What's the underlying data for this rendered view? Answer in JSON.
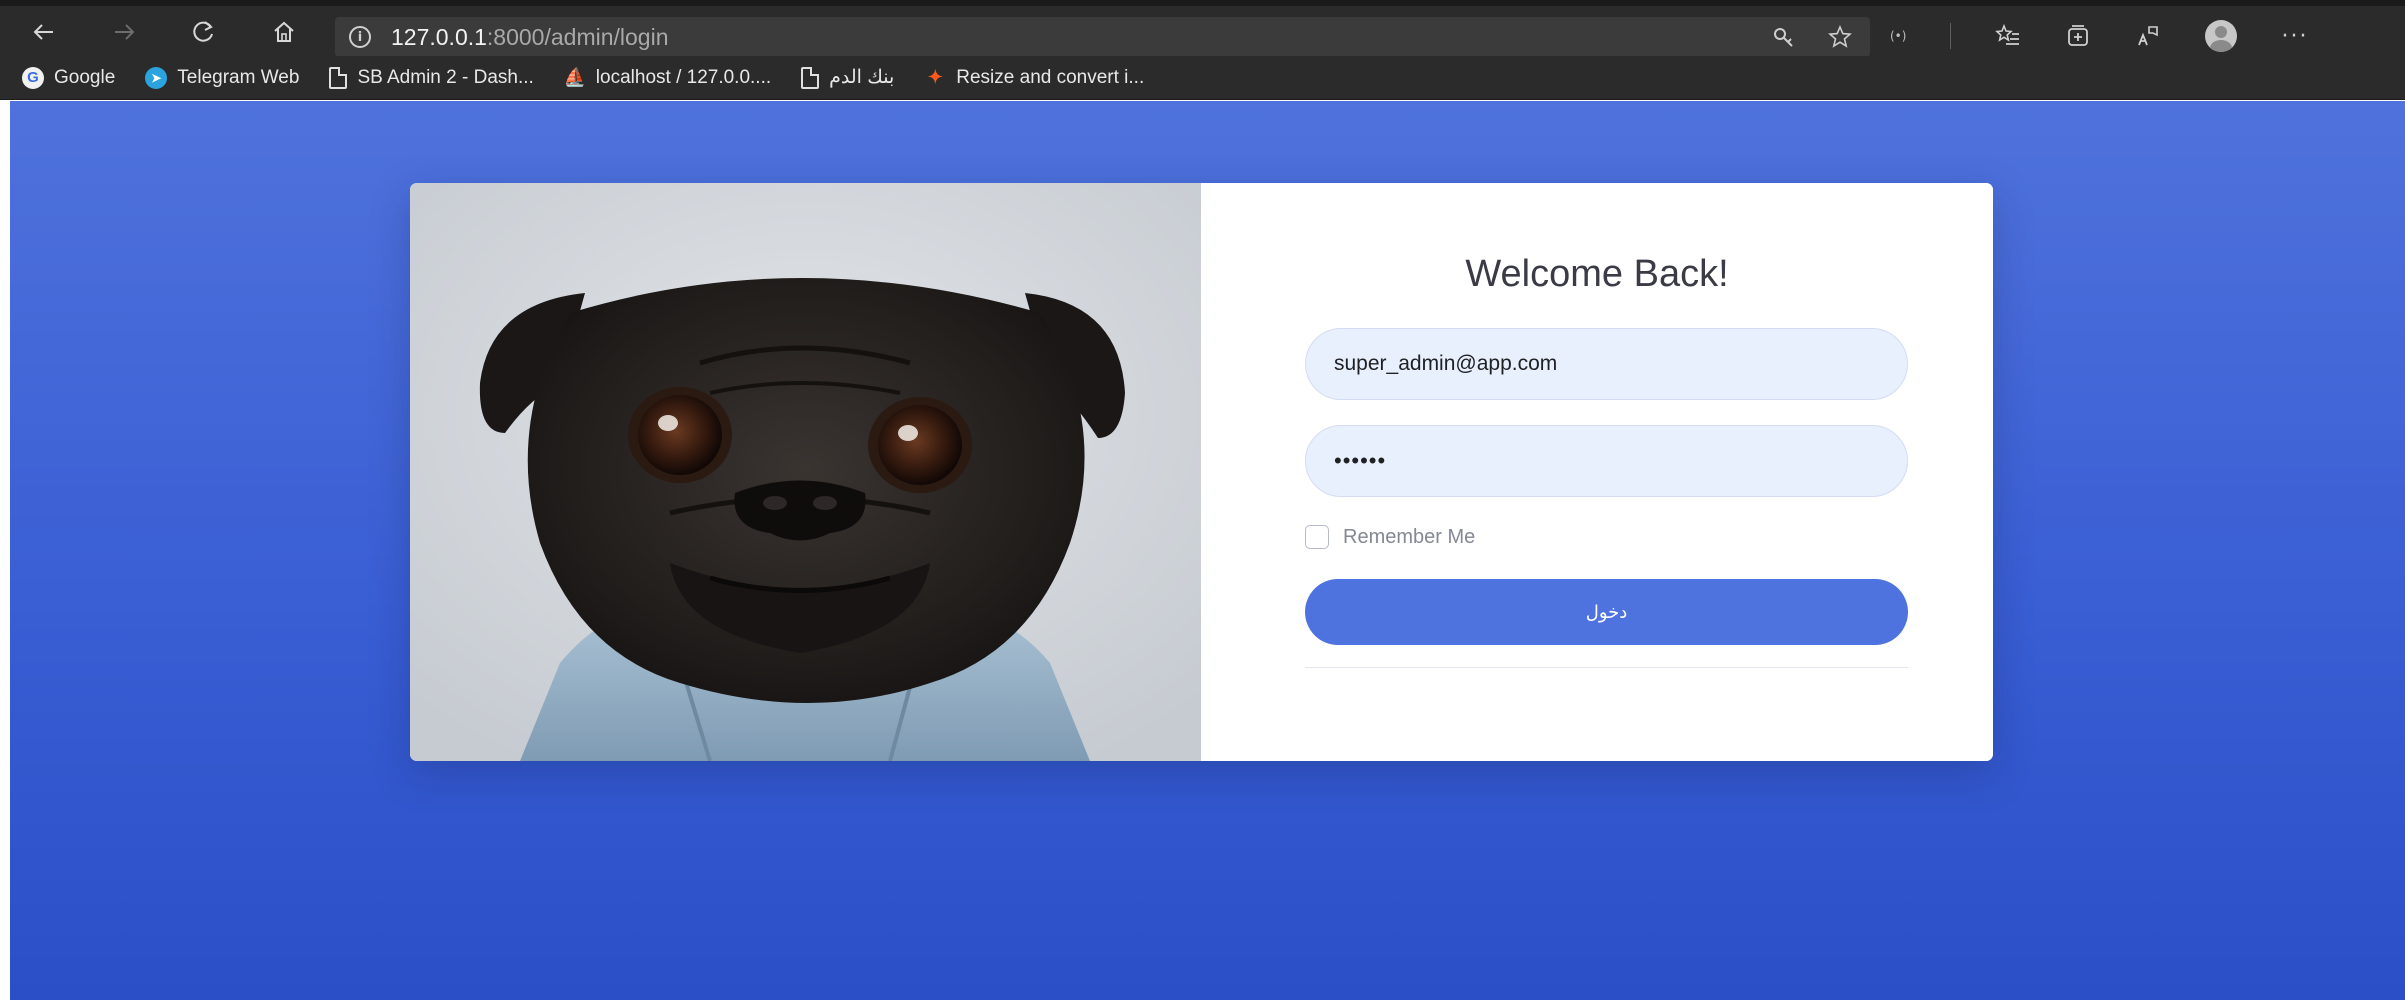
{
  "browser": {
    "url_host": "127.0.0.1",
    "url_rest": ":8000/admin/login",
    "icons": {
      "back": "arrow-left-icon",
      "forward": "arrow-right-icon",
      "refresh": "refresh-icon",
      "home": "home-icon",
      "site_info": "info-icon",
      "key": "key-icon",
      "favorite": "star-icon",
      "sensor": "sensor-icon",
      "favorites": "favorites-icon",
      "collections": "collections-icon",
      "read_aloud": "read-aloud-icon",
      "profile": "profile-icon",
      "more": "more-icon"
    },
    "bookmarks": [
      {
        "label": "Google",
        "icon": "google-icon"
      },
      {
        "label": "Telegram Web",
        "icon": "telegram-icon"
      },
      {
        "label": "SB Admin 2 - Dash...",
        "icon": "page-icon"
      },
      {
        "label": "localhost / 127.0.0....",
        "icon": "phpmyadmin-icon"
      },
      {
        "label": "بنك الدم",
        "icon": "page-icon"
      },
      {
        "label": "Resize and convert i...",
        "icon": "resize-icon"
      }
    ]
  },
  "login": {
    "image_alt": "pug-dog-photo",
    "title": "Welcome Back!",
    "email_value": "super_admin@app.com",
    "password_value": "••••••",
    "remember_label": "Remember Me",
    "submit_label": "دخول"
  },
  "colors": {
    "page_bg_top": "#4f72dc",
    "page_bg_bottom": "#2a4fc7",
    "primary": "#4e73df",
    "input_bg": "#e8f0fe"
  }
}
